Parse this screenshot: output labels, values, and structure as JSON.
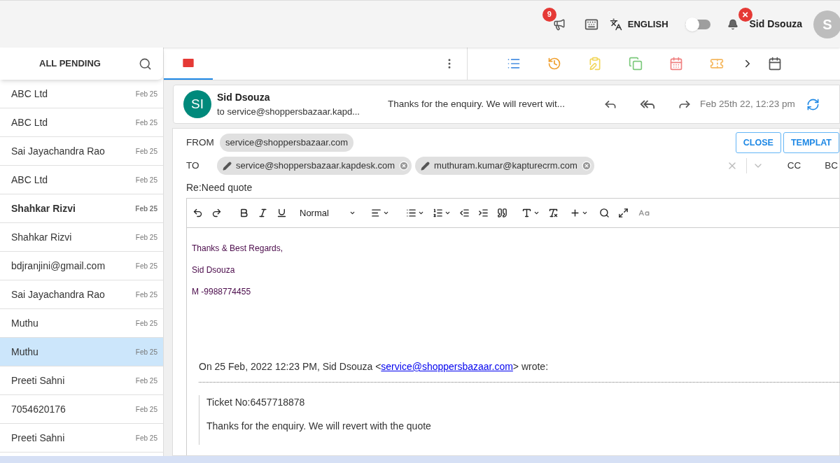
{
  "topbar": {
    "announcement_badge": "9",
    "language": "ENGLISH",
    "language_toggle": {
      "on": false
    },
    "notification_badge": "×",
    "user_name": "Sid Dsouza",
    "avatar_letter": "S"
  },
  "sidebar": {
    "title": "ALL PENDING",
    "items": [
      {
        "name": "ABC Ltd",
        "date": "Feb 25",
        "unread": false,
        "selected": false
      },
      {
        "name": "ABC Ltd",
        "date": "Feb 25",
        "unread": false,
        "selected": false
      },
      {
        "name": "Sai Jayachandra Rao",
        "date": "Feb 25",
        "unread": false,
        "selected": false
      },
      {
        "name": "ABC Ltd",
        "date": "Feb 25",
        "unread": false,
        "selected": false
      },
      {
        "name": "Shahkar Rizvi",
        "date": "Feb 25",
        "unread": true,
        "selected": false
      },
      {
        "name": "Shahkar Rizvi",
        "date": "Feb 25",
        "unread": false,
        "selected": false
      },
      {
        "name": "bdjranjini@gmail.com",
        "date": "Feb 25",
        "unread": false,
        "selected": false
      },
      {
        "name": "Sai Jayachandra Rao",
        "date": "Feb 25",
        "unread": false,
        "selected": false
      },
      {
        "name": "Muthu",
        "date": "Feb 25",
        "unread": false,
        "selected": false
      },
      {
        "name": "Muthu",
        "date": "Feb 25",
        "unread": false,
        "selected": true
      },
      {
        "name": "Preeti Sahni",
        "date": "Feb 25",
        "unread": false,
        "selected": false
      },
      {
        "name": "7054620176",
        "date": "Feb 25",
        "unread": false,
        "selected": false
      },
      {
        "name": "Preeti Sahni",
        "date": "Feb 25",
        "unread": false,
        "selected": false
      }
    ]
  },
  "tabs": [
    {
      "kind": "mail",
      "selected": true
    }
  ],
  "tool_tabs": [
    {
      "kind": "list"
    },
    {
      "kind": "history"
    },
    {
      "kind": "note"
    },
    {
      "kind": "copy"
    },
    {
      "kind": "calendar"
    },
    {
      "kind": "ticket"
    }
  ],
  "message": {
    "avatar": "SI",
    "sender": "Sid Dsouza",
    "to": "to service@shoppersbazaar.kapd...",
    "preview": "Thanks for the enquiry. We will revert wit...",
    "date": "Feb 25th 22, 12:23 pm"
  },
  "compose": {
    "from_label": "FROM",
    "from": "service@shoppersbazaar.com",
    "to_label": "TO",
    "to": [
      "service@shoppersbazaar.kapdesk.com",
      "muthuram.kumar@kapturecrm.com"
    ],
    "cc": "CC",
    "bcc": "BC",
    "buttons": [
      "CLOSE",
      "TEMPLAT"
    ],
    "subject": "Re:Need quote",
    "format": "Normal",
    "signature": [
      "Thanks & Best Regards,",
      "Sid Dsouza",
      "M -9988774455"
    ],
    "quote_intro": {
      "before": "On 25 Feb, 2022 12:23 PM, Sid Dsouza <",
      "link": "service@shoppersbazaar.com",
      "after": "> wrote:"
    },
    "quoted": [
      "Ticket No:6457718878",
      "Thanks for the enquiry. We will revert with the quote"
    ]
  }
}
